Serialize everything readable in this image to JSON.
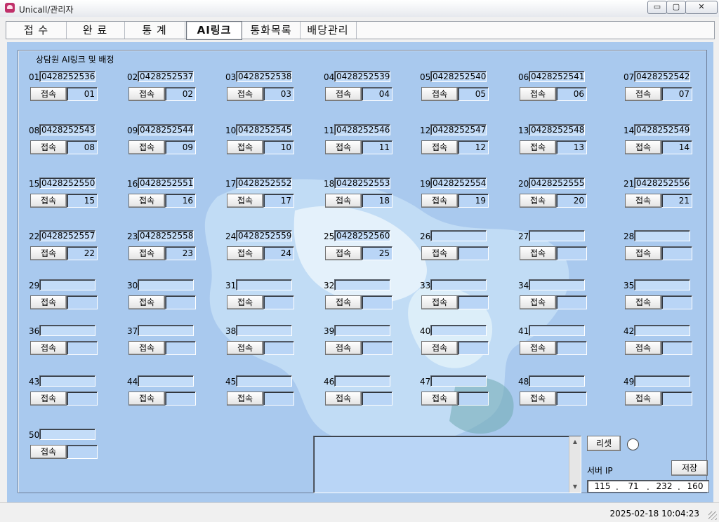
{
  "window": {
    "title": "Unicall/관리자",
    "minimize_glyph": "▭",
    "maximize_glyph": "▢",
    "close_glyph": "✕",
    "icon": "phone-app-icon"
  },
  "tabs": [
    "접 수",
    "완 료",
    "통 계",
    "AI링크",
    "통화목록",
    "배당관리"
  ],
  "active_tab": "AI링크",
  "panel_title": "상담원 AI링크 및 배정",
  "connect_label": "접속",
  "agents": [
    {
      "num": "01",
      "phone": "0428252536",
      "seat": "01"
    },
    {
      "num": "02",
      "phone": "0428252537",
      "seat": "02"
    },
    {
      "num": "03",
      "phone": "0428252538",
      "seat": "03"
    },
    {
      "num": "04",
      "phone": "0428252539",
      "seat": "04"
    },
    {
      "num": "05",
      "phone": "0428252540",
      "seat": "05"
    },
    {
      "num": "06",
      "phone": "0428252541",
      "seat": "06"
    },
    {
      "num": "07",
      "phone": "0428252542",
      "seat": "07"
    },
    {
      "num": "08",
      "phone": "0428252543",
      "seat": "08"
    },
    {
      "num": "09",
      "phone": "0428252544",
      "seat": "09"
    },
    {
      "num": "10",
      "phone": "0428252545",
      "seat": "10"
    },
    {
      "num": "11",
      "phone": "0428252546",
      "seat": "11"
    },
    {
      "num": "12",
      "phone": "0428252547",
      "seat": "12"
    },
    {
      "num": "13",
      "phone": "0428252548",
      "seat": "13"
    },
    {
      "num": "14",
      "phone": "0428252549",
      "seat": "14"
    },
    {
      "num": "15",
      "phone": "0428252550",
      "seat": "15"
    },
    {
      "num": "16",
      "phone": "0428252551",
      "seat": "16"
    },
    {
      "num": "17",
      "phone": "0428252552",
      "seat": "17"
    },
    {
      "num": "18",
      "phone": "0428252553",
      "seat": "18"
    },
    {
      "num": "19",
      "phone": "0428252554",
      "seat": "19"
    },
    {
      "num": "20",
      "phone": "0428252555",
      "seat": "20"
    },
    {
      "num": "21",
      "phone": "0428252556",
      "seat": "21"
    },
    {
      "num": "22",
      "phone": "0428252557",
      "seat": "22"
    },
    {
      "num": "23",
      "phone": "0428252558",
      "seat": "23"
    },
    {
      "num": "24",
      "phone": "0428252559",
      "seat": "24"
    },
    {
      "num": "25",
      "phone": "0428252560",
      "seat": "25"
    },
    {
      "num": "26",
      "phone": "",
      "seat": ""
    },
    {
      "num": "27",
      "phone": "",
      "seat": ""
    },
    {
      "num": "28",
      "phone": "",
      "seat": ""
    },
    {
      "num": "29",
      "phone": "",
      "seat": ""
    },
    {
      "num": "30",
      "phone": "",
      "seat": ""
    },
    {
      "num": "31",
      "phone": "",
      "seat": ""
    },
    {
      "num": "32",
      "phone": "",
      "seat": ""
    },
    {
      "num": "33",
      "phone": "",
      "seat": ""
    },
    {
      "num": "34",
      "phone": "",
      "seat": ""
    },
    {
      "num": "35",
      "phone": "",
      "seat": ""
    },
    {
      "num": "36",
      "phone": "",
      "seat": ""
    },
    {
      "num": "37",
      "phone": "",
      "seat": ""
    },
    {
      "num": "38",
      "phone": "",
      "seat": ""
    },
    {
      "num": "39",
      "phone": "",
      "seat": ""
    },
    {
      "num": "40",
      "phone": "",
      "seat": ""
    },
    {
      "num": "41",
      "phone": "",
      "seat": ""
    },
    {
      "num": "42",
      "phone": "",
      "seat": ""
    },
    {
      "num": "43",
      "phone": "",
      "seat": ""
    },
    {
      "num": "44",
      "phone": "",
      "seat": ""
    },
    {
      "num": "45",
      "phone": "",
      "seat": ""
    },
    {
      "num": "46",
      "phone": "",
      "seat": ""
    },
    {
      "num": "47",
      "phone": "",
      "seat": ""
    },
    {
      "num": "48",
      "phone": "",
      "seat": ""
    },
    {
      "num": "49",
      "phone": "",
      "seat": ""
    },
    {
      "num": "50",
      "phone": "",
      "seat": ""
    }
  ],
  "controls": {
    "reset_label": "리셋",
    "save_label": "저장",
    "server_ip_label": "서버 IP",
    "ip": [
      "115",
      "71",
      "232",
      "160"
    ],
    "ip_separator": "."
  },
  "status": {
    "datetime": "2025-02-18 10:04:23"
  },
  "colors": {
    "panel_bg": "#a9c9ee",
    "field_bg": "#b9d5f6"
  }
}
